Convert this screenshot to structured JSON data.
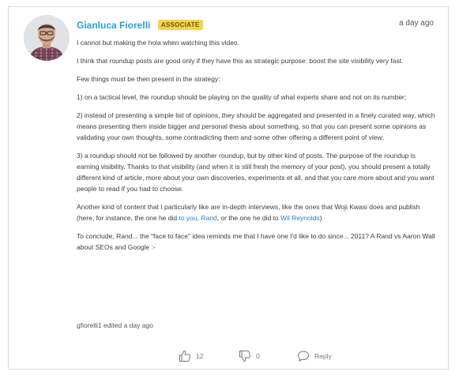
{
  "comment": {
    "author": "Gianluca Fiorelli",
    "badge": "ASSOCIATE",
    "timestamp": "a day ago",
    "paragraphs": {
      "p1": "I cannot but making the hola when watching this video.",
      "p2": "I think that roundup posts are good only if they have this as strategic purpose: boost the site visibility very fast.",
      "p3": "Few things must be then present in the strategy:",
      "p4": "1) on a tactical level, the roundup should be playing on the quality of what experts share and not on its number;",
      "p5": "2) instead of presenting a simple list of opinions, they should be aggregated and presented in a finely curated way, which means presenting them inside bigger and personal thesis about something, so that you can present some opinions as validating your own thoughts, some contradicting them and some other offering a different point of view;",
      "p6": "3) a roundup should not be followed by another roundup, but by other kind of posts. The purpose of the roundup is earning visibility. Thanks to that visibility (and when it is still fresh the memory of your post), you should present a totally different kind of article, more about your own discoveries, experiments et all, and that you care more about and you want people to read if you had to choose.",
      "p7_start": "Another kind of content that I particularly like are in-depth interviews, like the ones that Woji Kwasi does and publish (here, for instance, the one he did ",
      "p7_link1": "to you, Rand",
      "p7_mid": ", or the one he did to ",
      "p7_link2": "Wil Reynolds",
      "p7_end": ")",
      "p8": "To conclude, Rand... the \"face to face\" idea reminds me that I have one I'd like to do since... 2011? A Rand vs Aaron Wall about SEOs and Google :-"
    },
    "edited": "gfiorelli1 edited a day ago",
    "actions": {
      "upvotes": "12",
      "downvotes": "0",
      "reply_label": "Reply"
    }
  },
  "colors": {
    "author": "#2a9fd6",
    "badge_bg": "#f5d547",
    "link": "#2a7fc4"
  }
}
